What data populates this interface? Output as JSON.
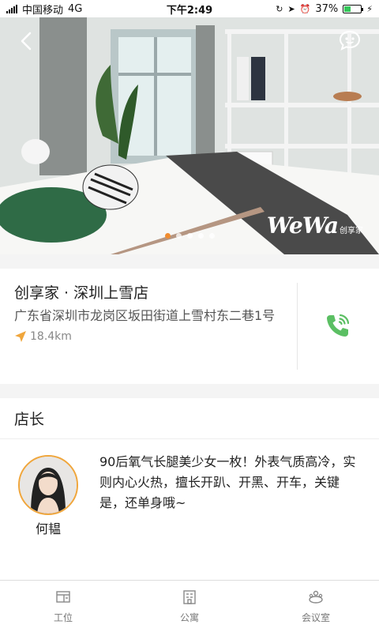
{
  "status_bar": {
    "carrier": "中国移动",
    "network": "4G",
    "time": "下午2:49",
    "battery_percent": "37%",
    "battery_level": 0.37
  },
  "hero": {
    "brand_text": "WeWa",
    "brand_sub": "创享家",
    "page_count": 5,
    "active_page": 1,
    "accent_color": "#f08c2f"
  },
  "store": {
    "name": "创享家 · 深圳上雪店",
    "address": "广东省深圳市龙岗区坂田街道上雪村东二巷1号",
    "distance": "18.4km",
    "phone_icon": "phone-icon",
    "accent_color": "#5bbf63"
  },
  "manager_section": {
    "title": "店长",
    "name": "何韫",
    "bio": "90后氧气长腿美少女一枚！外表气质高冷，实则内心火热，擅长开趴、开黑、开车，关键是，还单身哦~"
  },
  "bottom_nav": {
    "items": [
      {
        "label": "工位",
        "icon": "desk-icon"
      },
      {
        "label": "公寓",
        "icon": "apartment-icon"
      },
      {
        "label": "会议室",
        "icon": "meeting-room-icon"
      }
    ]
  }
}
